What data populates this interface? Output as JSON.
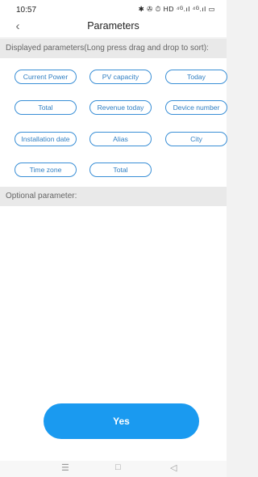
{
  "status_bar": {
    "time": "10:57",
    "icons": "✱ ✇ ⏱ HD ⁴ᴳ.ıl ⁴ᴳ.ıl ▭"
  },
  "header": {
    "back_icon": "chevron-left-icon",
    "title": "Parameters"
  },
  "displayed_section": {
    "label": "Displayed parameters(Long press drag and drop to sort):",
    "chips": [
      "Current Power",
      "PV capacity",
      "Today",
      "Total",
      "Revenue today",
      "Device number",
      "Installation date",
      "Alias",
      "City",
      "Time zone",
      "Total"
    ]
  },
  "optional_section": {
    "label": "Optional parameter:"
  },
  "actions": {
    "yes_label": "Yes"
  },
  "navigation": {
    "menu_icon": "menu-icon",
    "home_icon": "home-square-icon",
    "back_icon": "back-triangle-icon"
  },
  "colors": {
    "accent": "#1a9af0",
    "chip_border": "#3a8fd6",
    "section_bg": "#e9e9e9"
  }
}
